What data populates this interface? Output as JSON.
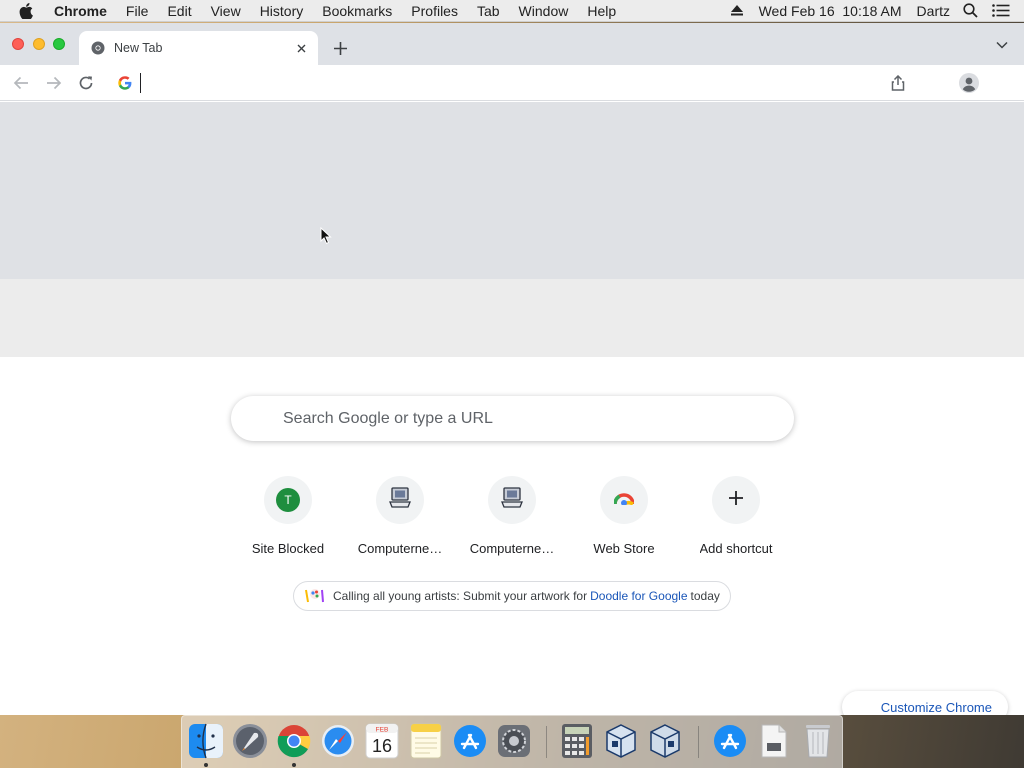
{
  "menubar": {
    "app_name": "Chrome",
    "menus": [
      "File",
      "Edit",
      "View",
      "History",
      "Bookmarks",
      "Profiles",
      "Tab",
      "Window",
      "Help"
    ],
    "datetime": "Wed Feb 16  10:18 AM",
    "user": "Dartz"
  },
  "browser": {
    "tab_title": "New Tab",
    "omnibox_value": ""
  },
  "ntp": {
    "search_placeholder": "Search Google or type a URL",
    "shortcuts": [
      {
        "label": "Site Blocked",
        "icon": "letter-t-icon",
        "letter": "T"
      },
      {
        "label": "Computerne…",
        "icon": "computer-icon"
      },
      {
        "label": "Computerne…",
        "icon": "computer-icon"
      },
      {
        "label": "Web Store",
        "icon": "webstore-icon"
      },
      {
        "label": "Add shortcut",
        "icon": "plus-icon"
      }
    ],
    "promo": {
      "text": "Calling all young artists: Submit your artwork for",
      "link": "Doodle for Google",
      "suffix": "today"
    },
    "customize_label": "Customize Chrome"
  },
  "dock": {
    "apps": [
      "finder",
      "launchpad",
      "chrome",
      "safari",
      "calendar",
      "notes",
      "app-store",
      "system-preferences",
      "calculator",
      "virtualbox",
      "virtualbox-vm",
      "app-store-downloads",
      "documents",
      "trash"
    ],
    "calendar_month": "FEB",
    "calendar_day": "16"
  },
  "colors": {
    "accent_link": "#1a56b8",
    "tabstrip": "#dee1e6",
    "doodle_band_top": "#dfe1e5",
    "doodle_band_bottom": "#ececec"
  }
}
